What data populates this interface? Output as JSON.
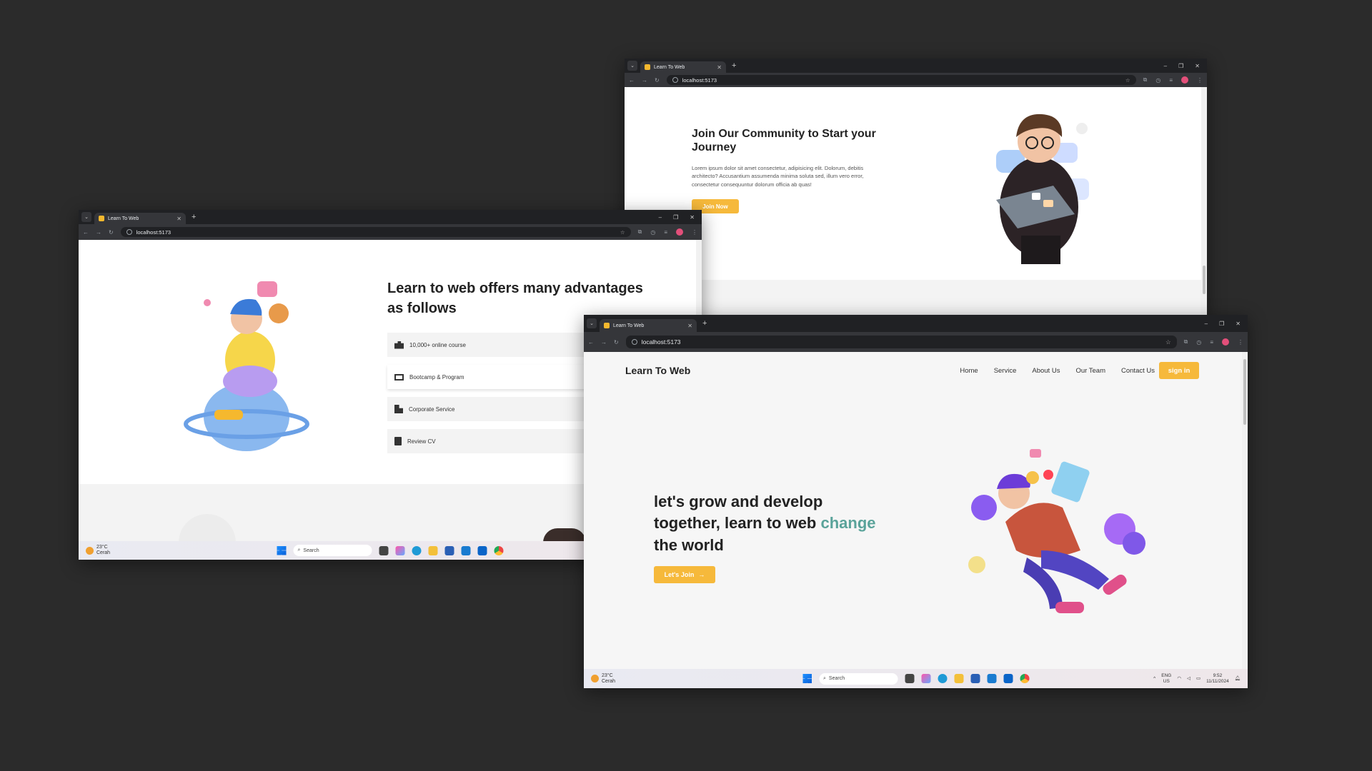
{
  "browser": {
    "tab_title": "Learn To Web",
    "url": "localhost:5173",
    "tab_close": "✕",
    "new_tab": "+",
    "win_minimize": "–",
    "win_restore": "❐",
    "win_close": "✕"
  },
  "taskbar": {
    "temp": "23°C",
    "condition": "Cerah",
    "search_label": "Search",
    "lang_top": "ENG",
    "lang_bottom": "US",
    "time": "9:52",
    "date": "11/11/2024"
  },
  "window_community": {
    "heading": "Join Our Community to Start your Journey",
    "body": "Lorem ipsum dolor sit amet consectetur, adipisicing elit. Dolorum, debitis architecto? Accusantium assumenda minima soluta sed, illum vero error, consectetur consequuntur dolorum officia ab quas!",
    "cta": "Join Now"
  },
  "window_advantages": {
    "heading": "Learn to web offers many advantages as follows",
    "items": [
      {
        "label": "10,000+ online course",
        "icon": "books-icon"
      },
      {
        "label": "Bootcamp & Program",
        "icon": "monitor-icon"
      },
      {
        "label": "Corporate Service",
        "icon": "building-icon"
      },
      {
        "label": "Review CV",
        "icon": "document-icon"
      }
    ]
  },
  "window_home": {
    "brand": "Learn To Web",
    "nav": [
      "Home",
      "Service",
      "About Us",
      "Our Team",
      "Contact Us"
    ],
    "signin": "sign in",
    "hero_line1": "let's grow and develop",
    "hero_line2_a": "together, learn to web",
    "hero_highlight": "change",
    "hero_line3": "the world",
    "cta": "Let's Join",
    "cta_arrow": "→"
  },
  "colors": {
    "accent": "#f6b93b",
    "highlight": "#5aa39a",
    "backdrop": "#2b2b2b"
  }
}
